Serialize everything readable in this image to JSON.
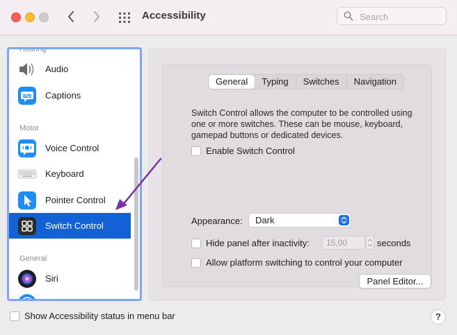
{
  "window": {
    "title": "Accessibility",
    "search": {
      "placeholder": "Search",
      "value": ""
    }
  },
  "sidebar": {
    "cut_header": "Hearing",
    "items": [
      {
        "label": "Audio",
        "icon": "speaker-icon"
      },
      {
        "label": "Captions",
        "icon": "captions-icon"
      },
      {
        "label": "Voice Control",
        "icon": "voice-control-icon"
      },
      {
        "label": "Keyboard",
        "icon": "keyboard-icon"
      },
      {
        "label": "Pointer Control",
        "icon": "pointer-icon"
      },
      {
        "label": "Switch Control",
        "icon": "switch-control-icon",
        "selected": true
      },
      {
        "label": "Siri",
        "icon": "siri-icon"
      }
    ],
    "sections": {
      "motor": "Motor",
      "general": "General"
    }
  },
  "tabs": [
    {
      "label": "General",
      "active": true
    },
    {
      "label": "Typing"
    },
    {
      "label": "Switches"
    },
    {
      "label": "Navigation"
    }
  ],
  "general": {
    "description": "Switch Control allows the computer to be controlled using one or more switches. These can be mouse, keyboard, gamepad buttons or dedicated devices.",
    "enable_label": "Enable Switch Control",
    "appearance_label": "Appearance:",
    "appearance_value": "Dark",
    "hide_panel_label": "Hide panel after inactivity:",
    "inactivity_value": "15,00",
    "seconds_label": "seconds",
    "platform_switching_label": "Allow platform switching to control your computer",
    "panel_editor_label": "Panel Editor..."
  },
  "footer": {
    "menu_bar_label": "Show Accessibility status in menu bar",
    "help_label": "?"
  },
  "colors": {
    "selection": "#1262d6",
    "sidebar_focus": "#7ea6f0",
    "annotation_arrow": "#7b2fa8"
  }
}
